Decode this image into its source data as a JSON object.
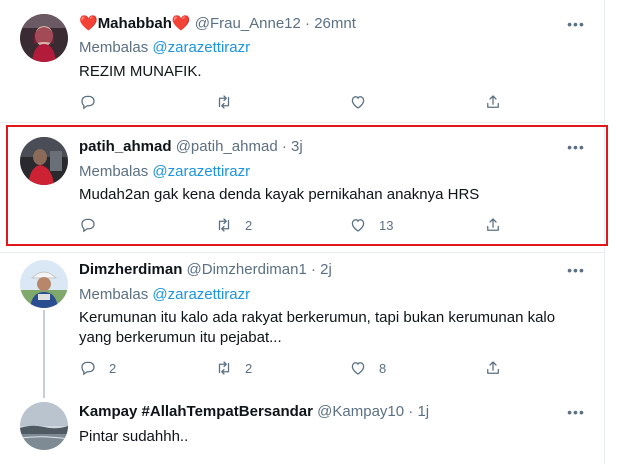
{
  "tweets": [
    {
      "name_prefix": "❤️",
      "name": "Mahabbah",
      "name_suffix": "❤️",
      "handle": "@Frau_Anne12",
      "time": "26mnt",
      "replying_label": "Membalas",
      "replying_to": "@zarazettirazr",
      "text": "REZIM MUNAFIK.",
      "reply_count": "",
      "retweet_count": "",
      "like_count": ""
    },
    {
      "name": "patih_ahmad",
      "handle": "@patih_ahmad",
      "time": "3j",
      "replying_label": "Membalas",
      "replying_to": "@zarazettirazr",
      "text": "Mudah2an gak kena denda kayak pernikahan anaknya HRS",
      "reply_count": "",
      "retweet_count": "2",
      "like_count": "13"
    },
    {
      "name": "Dimzherdiman",
      "handle": "@Dimzherdiman1",
      "time": "2j",
      "replying_label": "Membalas",
      "replying_to": "@zarazettirazr",
      "text_line1": "Kerumunan itu kalo ada rakyat berkerumun, tapi bukan kerumunan kalo",
      "text_line2": "yang berkerumun itu pejabat...",
      "reply_count": "2",
      "retweet_count": "2",
      "like_count": "8"
    },
    {
      "name": "Kampay #AllahTempatBersandar",
      "handle": "@Kampay10",
      "time": "1j",
      "text": "Pintar sudahhh.."
    }
  ],
  "dot": "·",
  "more_glyph": "•••",
  "icons": {
    "reply": "reply-icon",
    "retweet": "retweet-icon",
    "like": "heart-icon",
    "share": "share-icon",
    "more": "more-icon"
  },
  "colors": {
    "highlight_border": "#e0181b",
    "link": "#1b95e0",
    "muted": "#5b7083"
  }
}
